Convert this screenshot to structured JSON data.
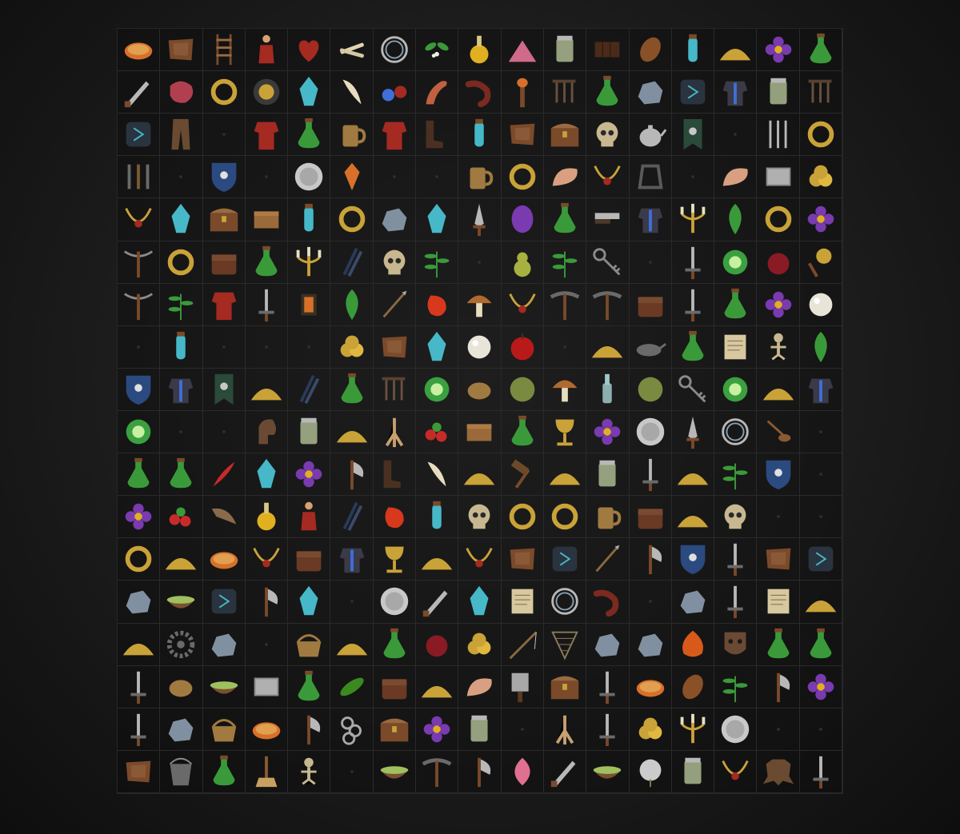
{
  "atlas": {
    "columns": 17,
    "rows": 18,
    "slots": [
      [
        "bread-icon",
        "leather-hide-icon",
        "ladder-icon",
        "doll-icon",
        "heart-icon",
        "bones-icon",
        "rope-coil-icon",
        "mistletoe-icon",
        "flask-round-icon",
        "gem-pile-icon",
        "jar-icon",
        "chocolate-bar-icon",
        "seed-icon",
        "vial-icon",
        "powder-pile-icon",
        "flower-icon",
        "potion-icon"
      ],
      [
        "knife-icon",
        "meat-icon",
        "ring-icon",
        "embroidery-icon",
        "crystal-icon",
        "tooth-icon",
        "double-vial-icon",
        "tentacle-icon",
        "sausage-icon",
        "torch-icon",
        "nails-icon",
        "potion-icon",
        "ore-icon",
        "rune-stone-icon",
        "armor-icon",
        "jar-icon",
        "nails-icon"
      ],
      [
        "rune-stone-icon",
        "trousers-icon",
        "empty-icon",
        "coat-icon",
        "potion-icon",
        "mug-icon",
        "coat-icon",
        "boots-icon",
        "vial-icon",
        "leather-hide-icon",
        "chest-icon",
        "skull-icon",
        "teapot-icon",
        "banner-icon",
        "empty-icon",
        "cutlery-icon",
        "ring-icon"
      ],
      [
        "tools-icon",
        "empty-icon",
        "shield-icon",
        "empty-icon",
        "plate-icon",
        "trinket-icon",
        "empty-icon",
        "empty-icon",
        "mug-icon",
        "ring-icon",
        "shell-icon",
        "necklace-icon",
        "stirrup-icon",
        "empty-icon",
        "shell-icon",
        "book-icon",
        "coin-pile-icon"
      ],
      [
        "necklace-icon",
        "crystal-icon",
        "chest-icon",
        "box-icon",
        "vial-icon",
        "ring-icon",
        "ore-icon",
        "crystal-icon",
        "dagger-icon",
        "gem-icon",
        "potion-icon",
        "razor-icon",
        "armor-icon",
        "candelabra-icon",
        "leaf-icon",
        "ring-icon",
        "flower-icon"
      ],
      [
        "crossbow-icon",
        "ring-icon",
        "bag-icon",
        "potion-icon",
        "candelabra-icon",
        "feathers-icon",
        "skull-icon",
        "herb-icon",
        "empty-icon",
        "pear-icon",
        "herb-icon",
        "key-icon",
        "empty-icon",
        "sword-icon",
        "glyph-icon",
        "fruit-icon",
        "rattle-icon"
      ],
      [
        "crossbow-icon",
        "herb-icon",
        "coat-icon",
        "sword-icon",
        "lantern-icon",
        "leaf-icon",
        "arrows-icon",
        "pepper-icon",
        "mushroom-icon",
        "necklace-icon",
        "pickaxe-icon",
        "pickaxe-icon",
        "bag-icon",
        "sword-icon",
        "potion-icon",
        "flower-icon",
        "pearl-icon"
      ],
      [
        "empty-icon",
        "vial-icon",
        "empty-icon",
        "empty-icon",
        "empty-icon",
        "coin-pile-icon",
        "leather-hide-icon",
        "crystal-icon",
        "pearl-icon",
        "apple-icon",
        "empty-icon",
        "powder-pile-icon",
        "lamp-icon",
        "potion-icon",
        "scroll-icon",
        "skeleton-icon",
        "leaf-icon"
      ],
      [
        "shield-icon",
        "armor-icon",
        "banner-icon",
        "powder-pile-icon",
        "feathers-icon",
        "potion-icon",
        "nails-icon",
        "glyph-icon",
        "potato-icon",
        "moss-icon",
        "mushroom-icon",
        "bottle-icon",
        "moss-icon",
        "key-icon",
        "glyph-icon",
        "powder-pile-icon",
        "armor-icon"
      ],
      [
        "glyph-icon",
        "empty-icon",
        "empty-icon",
        "horse-head-icon",
        "jar-icon",
        "powder-pile-icon",
        "root-icon",
        "berries-icon",
        "box-icon",
        "potion-icon",
        "chalice-icon",
        "flower-icon",
        "plate-icon",
        "dagger-icon",
        "rope-coil-icon",
        "ladle-icon",
        "empty-icon"
      ],
      [
        "potion-icon",
        "potion-icon",
        "quill-icon",
        "crystal-icon",
        "flower-icon",
        "axe-icon",
        "boots-icon",
        "tooth-icon",
        "powder-pile-icon",
        "hammer-icon",
        "powder-pile-icon",
        "jar-icon",
        "sword-icon",
        "powder-pile-icon",
        "herb-icon",
        "shield-icon",
        "empty-icon"
      ],
      [
        "flower-icon",
        "berries-icon",
        "horn-icon",
        "flask-round-icon",
        "doll-icon",
        "feathers-icon",
        "pepper-icon",
        "vial-icon",
        "skull-icon",
        "ring-icon",
        "ring-icon",
        "mug-icon",
        "bag-icon",
        "powder-pile-icon",
        "skull-icon",
        "empty-icon",
        "empty-icon"
      ],
      [
        "ring-icon",
        "powder-pile-icon",
        "bread-icon",
        "necklace-icon",
        "bag-icon",
        "armor-icon",
        "chalice-icon",
        "powder-pile-icon",
        "necklace-icon",
        "leather-hide-icon",
        "rune-stone-icon",
        "arrows-icon",
        "axe-icon",
        "shield-icon",
        "sword-icon",
        "leather-hide-icon",
        "rune-stone-icon"
      ],
      [
        "ore-icon",
        "bowl-icon",
        "rune-stone-icon",
        "axe-icon",
        "crystal-icon",
        "empty-icon",
        "plate-icon",
        "knife-icon",
        "crystal-icon",
        "scroll-icon",
        "rope-coil-icon",
        "sausage-icon",
        "empty-icon",
        "ore-icon",
        "sword-icon",
        "scroll-icon",
        "powder-pile-icon"
      ],
      [
        "powder-pile-icon",
        "gear-icon",
        "ore-icon",
        "empty-icon",
        "basket-icon",
        "powder-pile-icon",
        "potion-icon",
        "fruit-icon",
        "coin-pile-icon",
        "fishing-rod-icon",
        "net-icon",
        "ore-icon",
        "ore-icon",
        "onion-icon",
        "mask-icon",
        "potion-icon",
        "potion-icon"
      ],
      [
        "sword-icon",
        "potato-icon",
        "bowl-icon",
        "book-icon",
        "potion-icon",
        "cucumber-icon",
        "bag-icon",
        "powder-pile-icon",
        "shell-icon",
        "cleaver-icon",
        "chest-icon",
        "sword-icon",
        "bread-icon",
        "seed-icon",
        "herb-icon",
        "axe-icon",
        "flower-icon"
      ],
      [
        "sword-icon",
        "ore-icon",
        "basket-icon",
        "bread-icon",
        "axe-icon",
        "chain-icon",
        "chest-icon",
        "flower-icon",
        "jar-icon",
        "empty-icon",
        "root-icon",
        "sword-icon",
        "coin-pile-icon",
        "candelabra-icon",
        "plate-icon",
        "empty-icon",
        "empty-icon"
      ],
      [
        "leather-hide-icon",
        "bucket-icon",
        "potion-icon",
        "broom-icon",
        "skeleton-icon",
        "empty-icon",
        "bowl-icon",
        "pickaxe-icon",
        "axe-icon",
        "petal-icon",
        "knife-icon",
        "bowl-icon",
        "dandelion-icon",
        "jar-icon",
        "necklace-icon",
        "pelt-icon",
        "sword-icon"
      ]
    ]
  },
  "colors": {
    "background": "#1c1c1c",
    "grid_line": "#2a2a2a",
    "gold": "#c9a238",
    "red": "#a52a22",
    "blue": "#3f6fd8",
    "green": "#3a9a3a",
    "purple": "#7a3ab0",
    "cyan": "#46b8c8",
    "brown": "#7a4a2a",
    "silver": "#b8b8b8",
    "dark_iron": "#555555",
    "pink": "#d06a8a",
    "orange": "#d8702a",
    "yellow": "#e0b020"
  }
}
